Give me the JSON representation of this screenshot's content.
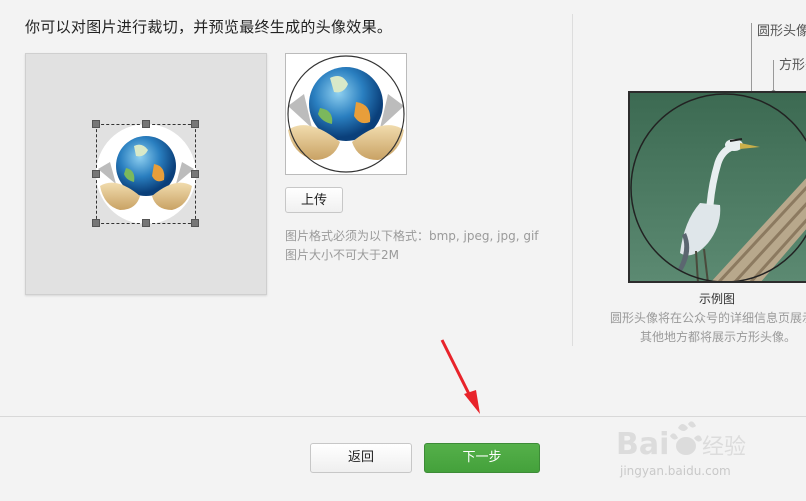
{
  "header": {
    "instruction": "你可以对图片进行裁切，并预览最终生成的头像效果。"
  },
  "upload": {
    "button_label": "上传",
    "hint_format": "图片格式必须为以下格式：bmp, jpeg, jpg, gif",
    "hint_size": "图片大小不可大于2M"
  },
  "example": {
    "label_round": "圆形头像",
    "label_square": "方形头像",
    "caption": "示例图",
    "desc_line1": "圆形头像将在公众号的详细信息页展示，",
    "desc_line2": "其他地方都将展示方形头像。"
  },
  "footer": {
    "back_label": "返回",
    "next_label": "下一步"
  },
  "watermark": {
    "brand": "Baidu 经验",
    "url": "jingyan.baidu.com"
  },
  "colors": {
    "primary_green": "#44a13b",
    "annotation_arrow": "#e8232a"
  },
  "icons": {
    "avatar_image": "globe-in-hands",
    "example_image": "heron-photo"
  }
}
